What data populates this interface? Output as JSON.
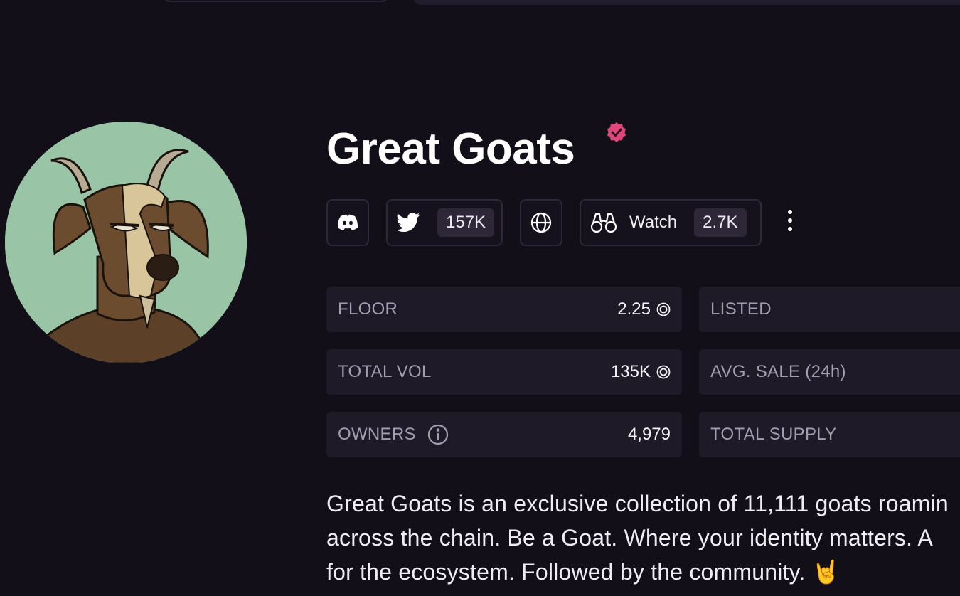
{
  "collection": {
    "name": "Great Goats",
    "verified": true,
    "accent_color": "#e0457b"
  },
  "social": {
    "discord": {
      "icon": "discord-icon"
    },
    "twitter": {
      "icon": "twitter-icon",
      "count": "157K"
    },
    "website": {
      "icon": "globe-icon"
    },
    "watch": {
      "icon": "binoculars-icon",
      "label": "Watch",
      "count": "2.7K"
    },
    "more": {
      "icon": "kebab-menu-icon"
    }
  },
  "stats": {
    "floor": {
      "label": "FLOOR",
      "value": "2.25"
    },
    "listed": {
      "label": "LISTED",
      "value": ""
    },
    "total_vol": {
      "label": "TOTAL VOL",
      "value": "135K"
    },
    "avg_sale": {
      "label": "AVG. SALE (24h)",
      "value": ""
    },
    "owners": {
      "label": "OWNERS",
      "value": "4,979"
    },
    "total_supply": {
      "label": "TOTAL SUPPLY",
      "value": ""
    }
  },
  "description": {
    "line1": "Great Goats is an exclusive collection of 11,111 goats roamin",
    "line2": "across the chain. Be a Goat. Where your identity matters. A",
    "line3": "for the ecosystem. Followed by the community. 🤘"
  }
}
